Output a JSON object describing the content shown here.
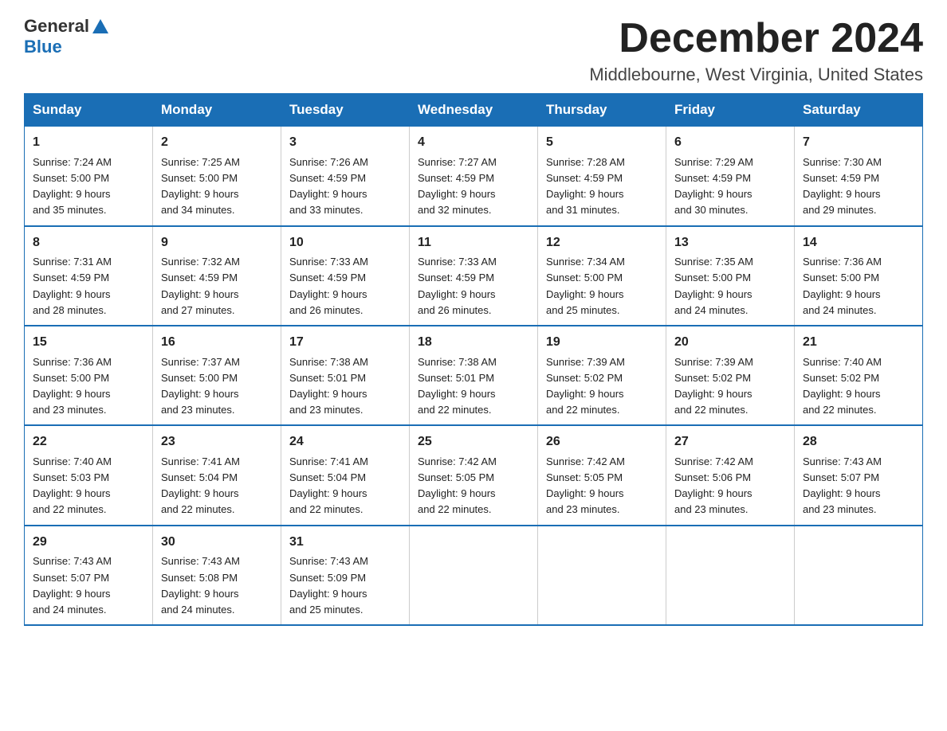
{
  "header": {
    "logo_general": "General",
    "logo_blue": "Blue",
    "month_title": "December 2024",
    "location": "Middlebourne, West Virginia, United States"
  },
  "days_of_week": [
    "Sunday",
    "Monday",
    "Tuesday",
    "Wednesday",
    "Thursday",
    "Friday",
    "Saturday"
  ],
  "weeks": [
    [
      {
        "day": "1",
        "sunrise": "7:24 AM",
        "sunset": "5:00 PM",
        "daylight": "9 hours and 35 minutes."
      },
      {
        "day": "2",
        "sunrise": "7:25 AM",
        "sunset": "5:00 PM",
        "daylight": "9 hours and 34 minutes."
      },
      {
        "day": "3",
        "sunrise": "7:26 AM",
        "sunset": "4:59 PM",
        "daylight": "9 hours and 33 minutes."
      },
      {
        "day": "4",
        "sunrise": "7:27 AM",
        "sunset": "4:59 PM",
        "daylight": "9 hours and 32 minutes."
      },
      {
        "day": "5",
        "sunrise": "7:28 AM",
        "sunset": "4:59 PM",
        "daylight": "9 hours and 31 minutes."
      },
      {
        "day": "6",
        "sunrise": "7:29 AM",
        "sunset": "4:59 PM",
        "daylight": "9 hours and 30 minutes."
      },
      {
        "day": "7",
        "sunrise": "7:30 AM",
        "sunset": "4:59 PM",
        "daylight": "9 hours and 29 minutes."
      }
    ],
    [
      {
        "day": "8",
        "sunrise": "7:31 AM",
        "sunset": "4:59 PM",
        "daylight": "9 hours and 28 minutes."
      },
      {
        "day": "9",
        "sunrise": "7:32 AM",
        "sunset": "4:59 PM",
        "daylight": "9 hours and 27 minutes."
      },
      {
        "day": "10",
        "sunrise": "7:33 AM",
        "sunset": "4:59 PM",
        "daylight": "9 hours and 26 minutes."
      },
      {
        "day": "11",
        "sunrise": "7:33 AM",
        "sunset": "4:59 PM",
        "daylight": "9 hours and 26 minutes."
      },
      {
        "day": "12",
        "sunrise": "7:34 AM",
        "sunset": "5:00 PM",
        "daylight": "9 hours and 25 minutes."
      },
      {
        "day": "13",
        "sunrise": "7:35 AM",
        "sunset": "5:00 PM",
        "daylight": "9 hours and 24 minutes."
      },
      {
        "day": "14",
        "sunrise": "7:36 AM",
        "sunset": "5:00 PM",
        "daylight": "9 hours and 24 minutes."
      }
    ],
    [
      {
        "day": "15",
        "sunrise": "7:36 AM",
        "sunset": "5:00 PM",
        "daylight": "9 hours and 23 minutes."
      },
      {
        "day": "16",
        "sunrise": "7:37 AM",
        "sunset": "5:00 PM",
        "daylight": "9 hours and 23 minutes."
      },
      {
        "day": "17",
        "sunrise": "7:38 AM",
        "sunset": "5:01 PM",
        "daylight": "9 hours and 23 minutes."
      },
      {
        "day": "18",
        "sunrise": "7:38 AM",
        "sunset": "5:01 PM",
        "daylight": "9 hours and 22 minutes."
      },
      {
        "day": "19",
        "sunrise": "7:39 AM",
        "sunset": "5:02 PM",
        "daylight": "9 hours and 22 minutes."
      },
      {
        "day": "20",
        "sunrise": "7:39 AM",
        "sunset": "5:02 PM",
        "daylight": "9 hours and 22 minutes."
      },
      {
        "day": "21",
        "sunrise": "7:40 AM",
        "sunset": "5:02 PM",
        "daylight": "9 hours and 22 minutes."
      }
    ],
    [
      {
        "day": "22",
        "sunrise": "7:40 AM",
        "sunset": "5:03 PM",
        "daylight": "9 hours and 22 minutes."
      },
      {
        "day": "23",
        "sunrise": "7:41 AM",
        "sunset": "5:04 PM",
        "daylight": "9 hours and 22 minutes."
      },
      {
        "day": "24",
        "sunrise": "7:41 AM",
        "sunset": "5:04 PM",
        "daylight": "9 hours and 22 minutes."
      },
      {
        "day": "25",
        "sunrise": "7:42 AM",
        "sunset": "5:05 PM",
        "daylight": "9 hours and 22 minutes."
      },
      {
        "day": "26",
        "sunrise": "7:42 AM",
        "sunset": "5:05 PM",
        "daylight": "9 hours and 23 minutes."
      },
      {
        "day": "27",
        "sunrise": "7:42 AM",
        "sunset": "5:06 PM",
        "daylight": "9 hours and 23 minutes."
      },
      {
        "day": "28",
        "sunrise": "7:43 AM",
        "sunset": "5:07 PM",
        "daylight": "9 hours and 23 minutes."
      }
    ],
    [
      {
        "day": "29",
        "sunrise": "7:43 AM",
        "sunset": "5:07 PM",
        "daylight": "9 hours and 24 minutes."
      },
      {
        "day": "30",
        "sunrise": "7:43 AM",
        "sunset": "5:08 PM",
        "daylight": "9 hours and 24 minutes."
      },
      {
        "day": "31",
        "sunrise": "7:43 AM",
        "sunset": "5:09 PM",
        "daylight": "9 hours and 25 minutes."
      },
      null,
      null,
      null,
      null
    ]
  ],
  "labels": {
    "sunrise": "Sunrise:",
    "sunset": "Sunset:",
    "daylight": "Daylight:"
  }
}
